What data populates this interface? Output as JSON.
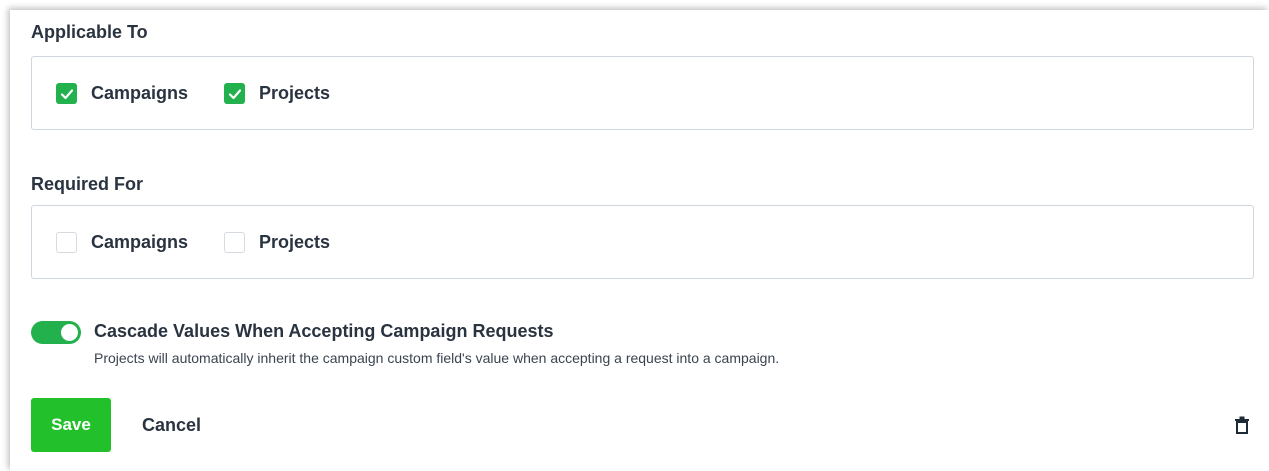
{
  "applicable_to": {
    "label": "Applicable To",
    "options": [
      {
        "label": "Campaigns",
        "checked": true
      },
      {
        "label": "Projects",
        "checked": true
      }
    ]
  },
  "required_for": {
    "label": "Required For",
    "options": [
      {
        "label": "Campaigns",
        "checked": false
      },
      {
        "label": "Projects",
        "checked": false
      }
    ]
  },
  "cascade": {
    "title": "Cascade Values When Accepting Campaign Requests",
    "description": "Projects will automatically inherit the campaign custom field's value when accepting a request into a campaign.",
    "enabled": true
  },
  "actions": {
    "save_label": "Save",
    "cancel_label": "Cancel",
    "delete_icon": "trash-icon"
  },
  "colors": {
    "accent": "#22b14c",
    "save_button": "#22c02b"
  }
}
